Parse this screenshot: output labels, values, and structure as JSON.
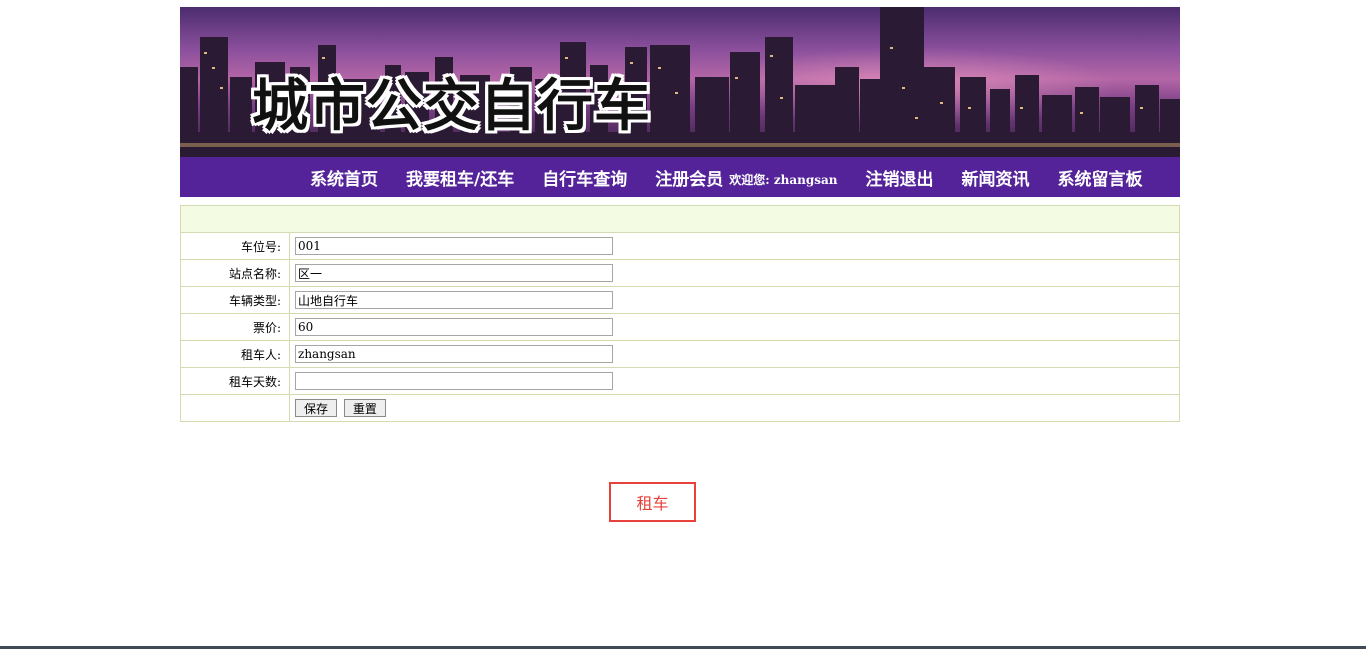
{
  "header": {
    "site_title": "城市公交自行车"
  },
  "nav": {
    "items": [
      "系统首页",
      "我要租车/还车",
      "自行车查询",
      "注册会员"
    ],
    "welcome": "欢迎您: zhangsan",
    "items_after": [
      "注销退出",
      "新闻资讯",
      "系统留言板"
    ]
  },
  "form": {
    "rows": [
      {
        "label": "车位号:",
        "value": "001"
      },
      {
        "label": "站点名称:",
        "value": "区一"
      },
      {
        "label": "车辆类型:",
        "value": "山地自行车"
      },
      {
        "label": "票价:",
        "value": "60"
      },
      {
        "label": "租车人:",
        "value": "zhangsan"
      },
      {
        "label": "租车天数:",
        "value": ""
      }
    ],
    "save_label": "保存",
    "reset_label": "重置"
  },
  "action": {
    "rent_label": "租车"
  },
  "colors": {
    "nav_bg": "#54239a",
    "header_row_bg": "#f3fbe3",
    "table_border": "#d4dbb0",
    "highlight": "#e8403b"
  }
}
